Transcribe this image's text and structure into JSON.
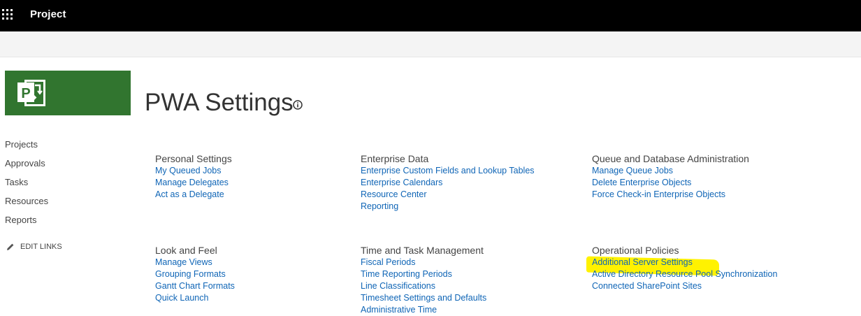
{
  "header": {
    "app_title": "Project"
  },
  "page": {
    "title": "PWA Settings"
  },
  "quick_launch": {
    "items": [
      {
        "label": "Projects"
      },
      {
        "label": "Approvals"
      },
      {
        "label": "Tasks"
      },
      {
        "label": "Resources"
      },
      {
        "label": "Reports"
      }
    ],
    "edit_links_label": "EDIT LINKS"
  },
  "sections": {
    "personal_settings": {
      "heading": "Personal Settings",
      "links": [
        "My Queued Jobs",
        "Manage Delegates",
        "Act as a Delegate"
      ]
    },
    "enterprise_data": {
      "heading": "Enterprise Data",
      "links": [
        "Enterprise Custom Fields and Lookup Tables",
        "Enterprise Calendars",
        "Resource Center",
        "Reporting"
      ]
    },
    "queue_db_admin": {
      "heading": "Queue and Database Administration",
      "links": [
        "Manage Queue Jobs",
        "Delete Enterprise Objects",
        "Force Check-in Enterprise Objects"
      ]
    },
    "look_and_feel": {
      "heading": "Look and Feel",
      "links": [
        "Manage Views",
        "Grouping Formats",
        "Gantt Chart Formats",
        "Quick Launch"
      ]
    },
    "time_task_mgmt": {
      "heading": "Time and Task Management",
      "links": [
        "Fiscal Periods",
        "Time Reporting Periods",
        "Line Classifications",
        "Timesheet Settings and Defaults",
        "Administrative Time"
      ]
    },
    "operational_policies": {
      "heading": "Operational Policies",
      "links": [
        "Additional Server Settings",
        "Active Directory Resource Pool Synchronization",
        "Connected SharePoint Sites"
      ]
    }
  },
  "colors": {
    "top_bar": "#000000",
    "ribbon": "#f4f4f4",
    "logo_green": "#31752f",
    "link": "#0f65b6",
    "highlight": "#fff200"
  },
  "icons": {
    "app_launcher": "waffle-icon",
    "logo": "project-logo-icon",
    "info": "info-icon",
    "edit": "pencil-icon"
  }
}
